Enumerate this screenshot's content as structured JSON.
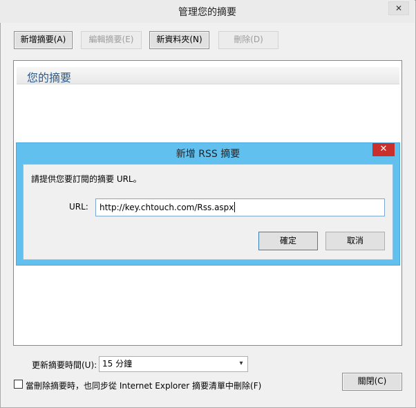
{
  "window": {
    "title": "管理您的摘要",
    "close_glyph": "✕"
  },
  "toolbar": {
    "new_feed": "新增摘要(A)",
    "edit_feed": "編輯摘要(E)",
    "new_folder": "新資料夾(N)",
    "delete": "刪除(D)"
  },
  "feeds_panel": {
    "header": "您的摘要"
  },
  "dialog": {
    "title": "新增 RSS 摘要",
    "close_glyph": "✕",
    "prompt": "請提供您要訂閱的摘要 URL。",
    "url_label": "URL:",
    "url_value": "http://key.chtouch.com/Rss.aspx",
    "ok_label": "確定",
    "cancel_label": "取消"
  },
  "footer": {
    "interval_label": "更新摘要時間(U):",
    "interval_value": "15 分鐘",
    "sync_checked": false,
    "sync_label": "當刪除摘要時，也同步從 Internet Explorer 摘要清單中刪除(F)",
    "close_label": "關閉(C)",
    "dropdown_icon": "chevron-down-icon"
  }
}
